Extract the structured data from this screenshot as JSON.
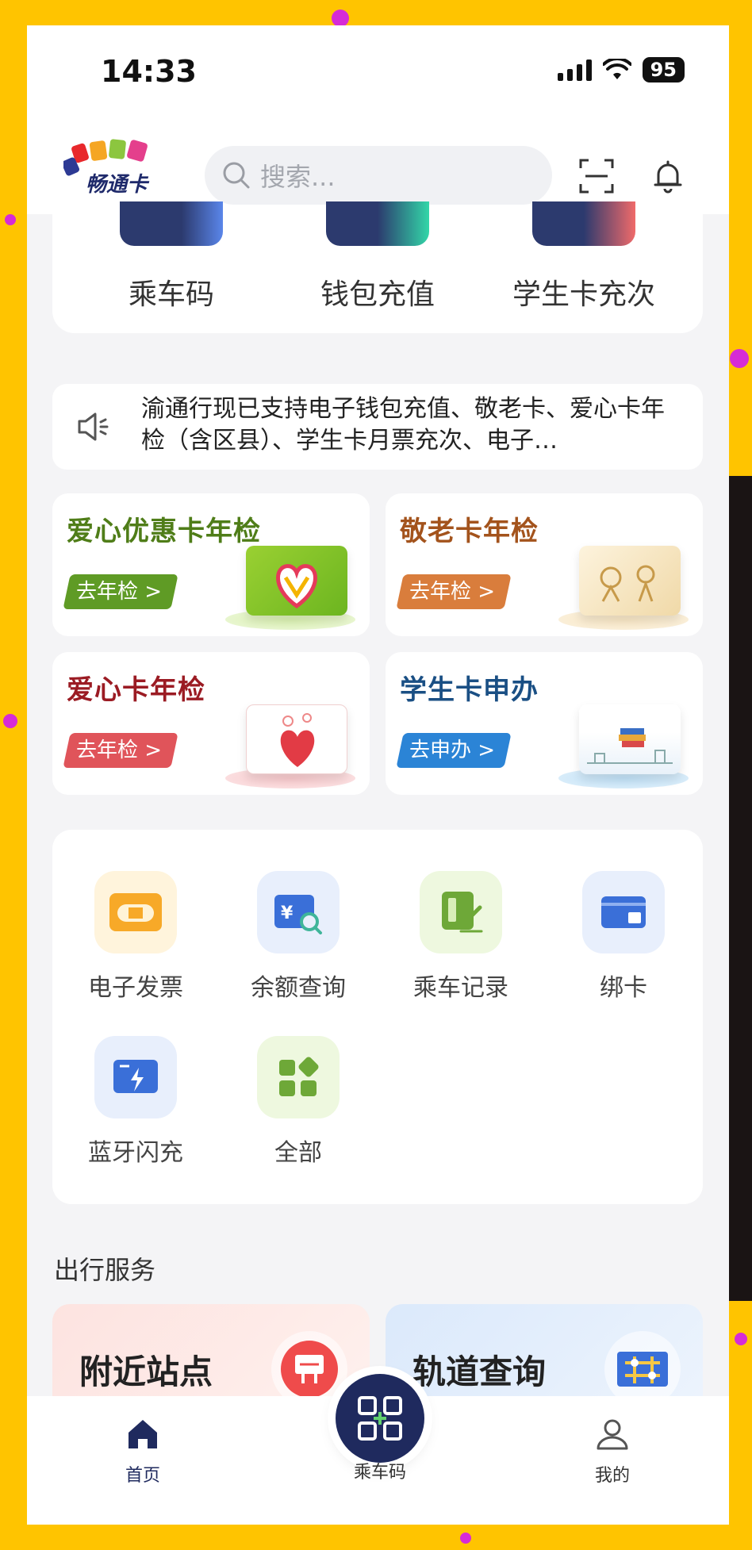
{
  "status": {
    "time": "14:33",
    "battery": "95"
  },
  "header": {
    "logo_text": "畅通卡",
    "search_placeholder": "搜索..."
  },
  "quick_actions": [
    {
      "label": "乘车码"
    },
    {
      "label": "钱包充值"
    },
    {
      "label": "学生卡充次"
    }
  ],
  "notice": {
    "text": "渝通行现已支持电子钱包充值、敬老卡、爱心卡年检（含区县）、学生卡月票充次、电子…"
  },
  "promos": [
    {
      "title": "爱心优惠卡年检",
      "button": "去年检 >",
      "title_color": "#4f7d18",
      "button_color": "#5f9b25"
    },
    {
      "title": "敬老卡年检",
      "button": "去年检 >",
      "title_color": "#a3531c",
      "button_color": "#d97d3c"
    },
    {
      "title": "爱心卡年检",
      "button": "去年检 >",
      "title_color": "#9b1b23",
      "button_color": "#e0545a"
    },
    {
      "title": "学生卡申办",
      "button": "去申办 >",
      "title_color": "#1a4f84",
      "button_color": "#2b84d6"
    }
  ],
  "services": [
    {
      "label": "电子发票",
      "icon": "invoice-icon"
    },
    {
      "label": "余额查询",
      "icon": "balance-search-icon"
    },
    {
      "label": "乘车记录",
      "icon": "ride-record-icon"
    },
    {
      "label": "绑卡",
      "icon": "bind-card-icon"
    },
    {
      "label": "蓝牙闪充",
      "icon": "bluetooth-charge-icon"
    },
    {
      "label": "全部",
      "icon": "all-apps-icon"
    }
  ],
  "travel": {
    "section_title": "出行服务",
    "items": [
      {
        "label": "附近站点",
        "icon": "bus-stop-icon"
      },
      {
        "label": "轨道查询",
        "icon": "metro-icon"
      }
    ]
  },
  "tabbar": {
    "home": "首页",
    "ride_code": "乘车码",
    "mine": "我的"
  }
}
